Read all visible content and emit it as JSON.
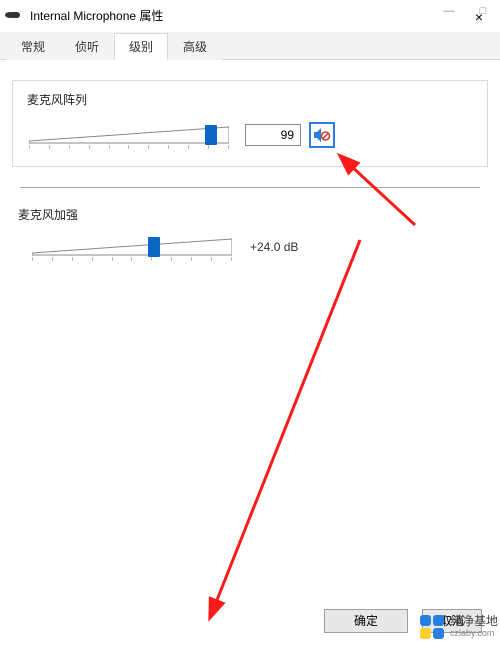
{
  "titlebar": {
    "icon": "microphone-icon",
    "title": "Internal Microphone 属性",
    "minimize": "—",
    "maximize": "□",
    "close": "×"
  },
  "tabs": {
    "items": [
      "常规",
      "侦听",
      "级别",
      "高级"
    ],
    "active_index": 2
  },
  "mic_array": {
    "title": "麦克风阵列",
    "value": "99",
    "slider_percent": 92,
    "mute_icon": "speaker-muted-icon"
  },
  "mic_boost": {
    "title": "麦克风加强",
    "value": "+24.0 dB",
    "slider_percent": 62
  },
  "buttons": {
    "ok": "确定",
    "cancel": "取消"
  },
  "watermark": {
    "brand": "纯净基地",
    "sub": "czlaby.com"
  }
}
